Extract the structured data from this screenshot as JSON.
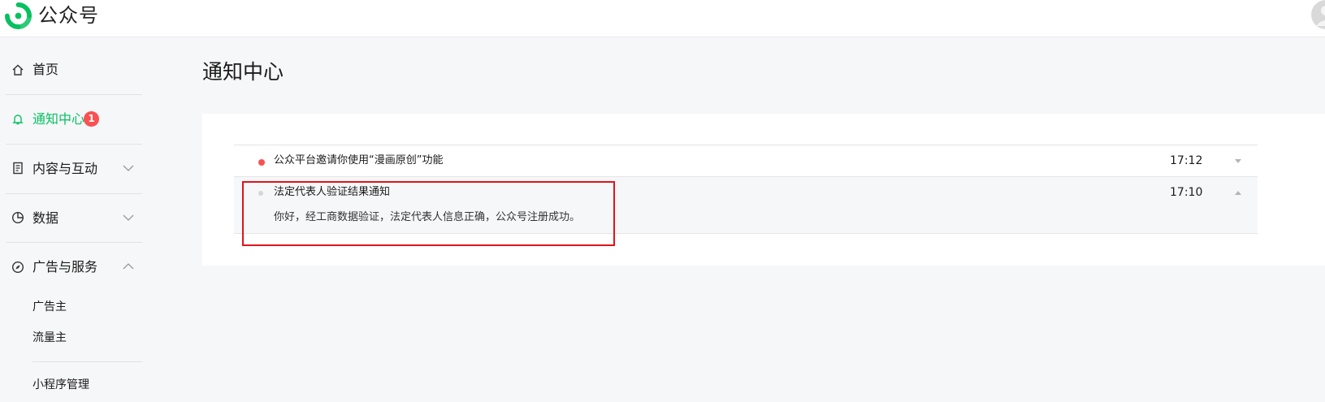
{
  "header": {
    "brand": "公众号",
    "logo_icon": "wechat-mp-logo",
    "brand_color": "#07c160"
  },
  "sidebar": {
    "items": [
      {
        "label": "首页",
        "icon": "home-icon"
      },
      {
        "label": "通知中心",
        "icon": "bell-icon",
        "badge": "1",
        "active": true
      },
      {
        "label": "内容与互动",
        "icon": "document-icon",
        "expanded": false
      },
      {
        "label": "数据",
        "icon": "pie-chart-icon",
        "expanded": false
      },
      {
        "label": "广告与服务",
        "icon": "compass-icon",
        "expanded": true,
        "children": [
          {
            "label": "广告主"
          },
          {
            "label": "流量主"
          }
        ]
      },
      {
        "label": "小程序管理"
      }
    ]
  },
  "main": {
    "title": "通知中心",
    "notices": [
      {
        "title": "公众平台邀请你使用“漫画原创”功能",
        "time": "17:12",
        "unread": true,
        "expanded": false
      },
      {
        "title": "法定代表人验证结果通知",
        "time": "17:10",
        "unread": false,
        "expanded": true,
        "body": "你好，经工商数据验证，法定代表人信息正确，公众号注册成功。"
      }
    ]
  },
  "colors": {
    "accent": "#07c160",
    "unread_dot": "#fa5151",
    "badge": "#fa5151",
    "highlight": "#e0141a"
  }
}
